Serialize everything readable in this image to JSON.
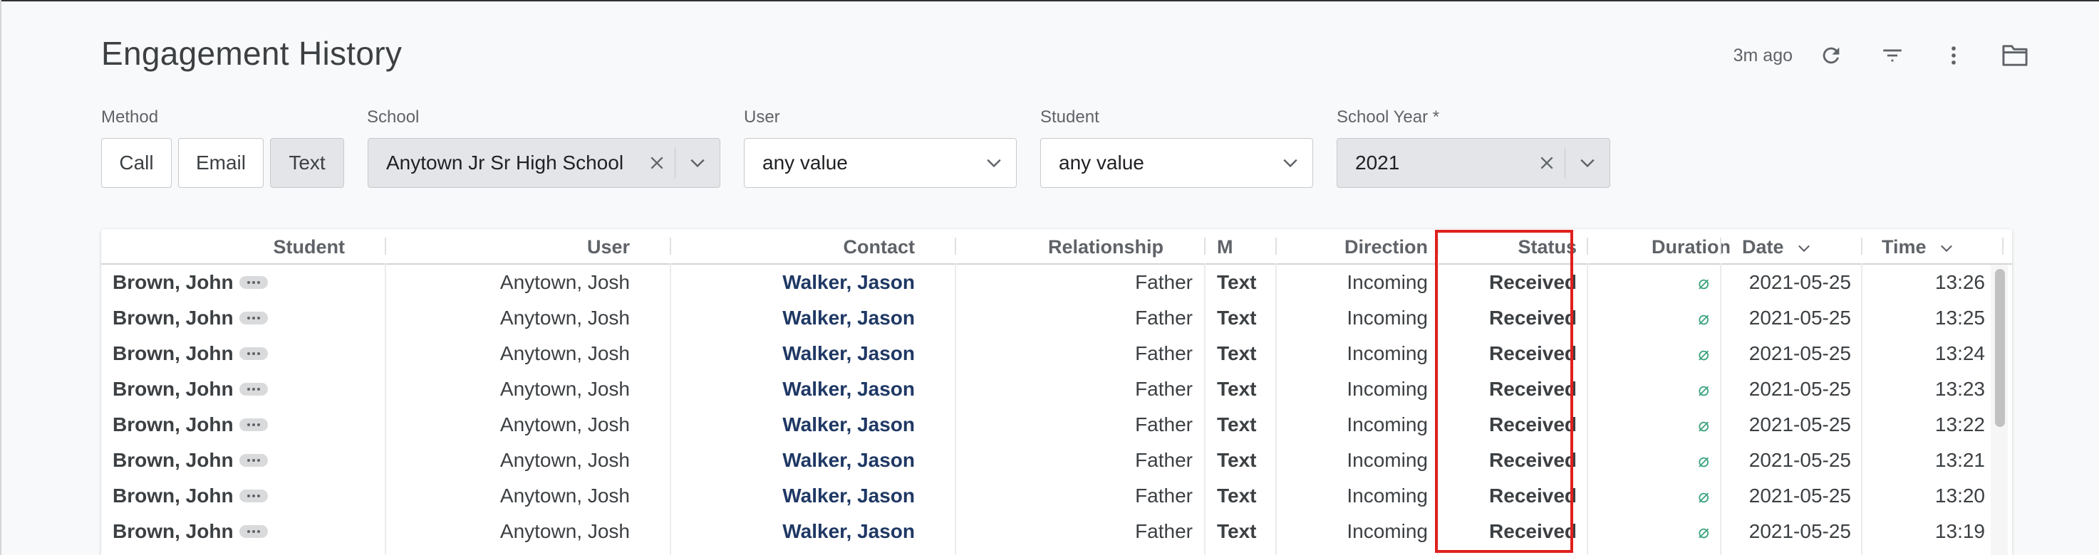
{
  "page": {
    "title": "Engagement History",
    "updated": "3m ago",
    "icons": [
      "refresh-icon",
      "filter-icon",
      "more-vert-icon",
      "folder-icon"
    ]
  },
  "filters": {
    "method": {
      "label": "Method",
      "options": [
        "Call",
        "Email",
        "Text"
      ],
      "selected": "Text"
    },
    "school": {
      "label": "School",
      "value": "Anytown Jr Sr High School"
    },
    "user": {
      "label": "User",
      "value": "any value"
    },
    "student": {
      "label": "Student",
      "value": "any value"
    },
    "school_year": {
      "label": "School Year *",
      "value": "2021"
    }
  },
  "table": {
    "columns": [
      "Student",
      "User",
      "Contact",
      "Relationship",
      "M",
      "Direction",
      "Status",
      "Duration",
      "Date",
      "Time"
    ],
    "highlighted_column": "Status",
    "colors": {
      "highlight": "#e0201d",
      "contact": "#1f3864",
      "null_icon": "#3aa37c"
    },
    "rows": [
      {
        "student": "Brown, John",
        "user": "Anytown, Josh",
        "contact": "Walker, Jason",
        "relationship": "Father",
        "method": "Text",
        "direction": "Incoming",
        "status": "Received",
        "duration": "⌀",
        "date": "2021-05-25",
        "time": "13:26"
      },
      {
        "student": "Brown, John",
        "user": "Anytown, Josh",
        "contact": "Walker, Jason",
        "relationship": "Father",
        "method": "Text",
        "direction": "Incoming",
        "status": "Received",
        "duration": "⌀",
        "date": "2021-05-25",
        "time": "13:25"
      },
      {
        "student": "Brown, John",
        "user": "Anytown, Josh",
        "contact": "Walker, Jason",
        "relationship": "Father",
        "method": "Text",
        "direction": "Incoming",
        "status": "Received",
        "duration": "⌀",
        "date": "2021-05-25",
        "time": "13:24"
      },
      {
        "student": "Brown, John",
        "user": "Anytown, Josh",
        "contact": "Walker, Jason",
        "relationship": "Father",
        "method": "Text",
        "direction": "Incoming",
        "status": "Received",
        "duration": "⌀",
        "date": "2021-05-25",
        "time": "13:23"
      },
      {
        "student": "Brown, John",
        "user": "Anytown, Josh",
        "contact": "Walker, Jason",
        "relationship": "Father",
        "method": "Text",
        "direction": "Incoming",
        "status": "Received",
        "duration": "⌀",
        "date": "2021-05-25",
        "time": "13:22"
      },
      {
        "student": "Brown, John",
        "user": "Anytown, Josh",
        "contact": "Walker, Jason",
        "relationship": "Father",
        "method": "Text",
        "direction": "Incoming",
        "status": "Received",
        "duration": "⌀",
        "date": "2021-05-25",
        "time": "13:21"
      },
      {
        "student": "Brown, John",
        "user": "Anytown, Josh",
        "contact": "Walker, Jason",
        "relationship": "Father",
        "method": "Text",
        "direction": "Incoming",
        "status": "Received",
        "duration": "⌀",
        "date": "2021-05-25",
        "time": "13:20"
      },
      {
        "student": "Brown, John",
        "user": "Anytown, Josh",
        "contact": "Walker, Jason",
        "relationship": "Father",
        "method": "Text",
        "direction": "Incoming",
        "status": "Received",
        "duration": "⌀",
        "date": "2021-05-25",
        "time": "13:19"
      }
    ]
  }
}
